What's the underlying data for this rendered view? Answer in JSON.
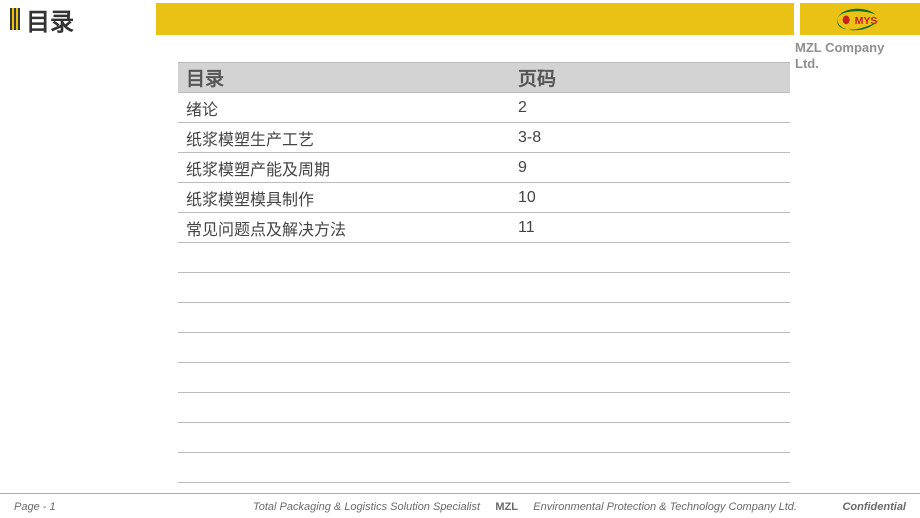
{
  "slide_title": "目录",
  "company": "MZL Company Ltd.",
  "logo_label": "MYS",
  "table": {
    "header_title": "目录",
    "header_page": "页码",
    "rows": [
      {
        "title": "绪论",
        "page": "2"
      },
      {
        "title": "纸浆模塑生产工艺",
        "page": "3-8"
      },
      {
        "title": "纸浆模塑产能及周期",
        "page": "9"
      },
      {
        "title": "纸浆模塑模具制作",
        "page": "10"
      },
      {
        "title": "常见问题点及解决方法",
        "page": "11"
      },
      {
        "title": "",
        "page": ""
      },
      {
        "title": "",
        "page": ""
      },
      {
        "title": "",
        "page": ""
      },
      {
        "title": "",
        "page": ""
      },
      {
        "title": "",
        "page": ""
      },
      {
        "title": "",
        "page": ""
      },
      {
        "title": "",
        "page": ""
      },
      {
        "title": "",
        "page": ""
      }
    ]
  },
  "footer": {
    "page_label": "Page  - 1",
    "center_left": "Total Packaging & Logistics Solution Specialist",
    "center_bold": "MZL",
    "center_right": "Environmental Protection & Technology Company Ltd.",
    "confidential": "Confidential"
  }
}
